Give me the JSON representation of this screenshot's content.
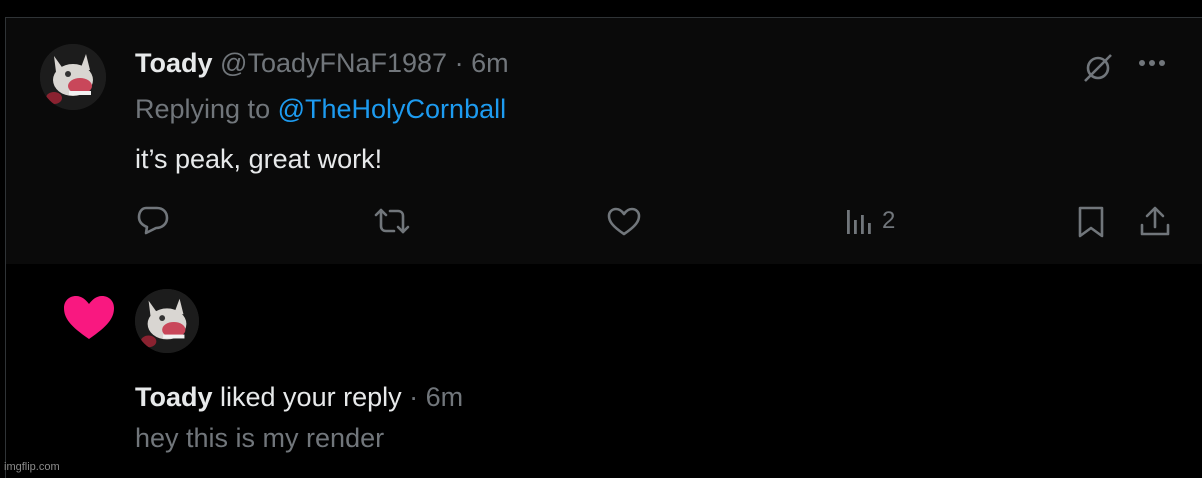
{
  "tweet": {
    "author_name": "Toady",
    "author_handle": "@ToadyFNaF1987",
    "separator": "·",
    "time": "6m",
    "replying_prefix": "Replying to ",
    "replying_to": "@TheHolyCornball",
    "text": "it’s peak, great work!",
    "views_count": "2",
    "icons": [
      "no-edit-icon",
      "more-icon",
      "reply-icon",
      "retweet-icon",
      "like-icon",
      "views-icon",
      "bookmark-icon",
      "share-icon"
    ]
  },
  "notification": {
    "actor_name": "Toady",
    "action": " liked your reply",
    "separator": " · ",
    "time": "6m",
    "liked_text": "hey this is my render",
    "heart_color": "#f91880"
  },
  "watermark": "imgflip.com",
  "colors": {
    "background": "#000000",
    "text_primary": "#e7e9ea",
    "text_secondary": "#71767b",
    "link": "#1d9bf0"
  }
}
